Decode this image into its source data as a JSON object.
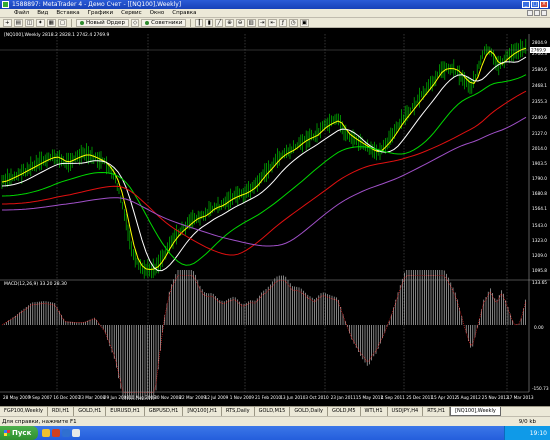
{
  "window": {
    "title": "1588897: MetaTrader 4 - Демо Счет - [[NQ100],Weekly]",
    "buttons": [
      "_",
      "□",
      "×"
    ]
  },
  "menu": {
    "items": [
      "Файл",
      "Вид",
      "Вставка",
      "Графики",
      "Сервис",
      "Окно",
      "Справка"
    ]
  },
  "toolbar": {
    "new_order": "Новый Ордер",
    "advisors": "Советники"
  },
  "chart": {
    "header": "[NQ100],Weekly  2818.2  2828.1  2742.4  2769.9",
    "current_price": "2769.9",
    "price_labels": [
      "2804.9",
      "2700.3",
      "2580.6",
      "2468.1",
      "2355.3",
      "2240.6",
      "2127.0",
      "2014.0",
      "1903.5",
      "1790.0",
      "1680.8",
      "1564.1",
      "1543.0",
      "1323.0",
      "1209.0",
      "1095.8",
      "981.0"
    ],
    "macd_header": "MACD(12,26,9)  33.20  28.30",
    "macd_labels": [
      "133.65",
      "0.00",
      "-150.73"
    ],
    "date_labels": [
      "28 May 2007",
      "9 Sep 2007",
      "16 Dec 2007",
      "23 Mar 2008",
      "29 Jun 2008",
      "10 Aug 2008",
      "30 Nov 2008",
      "22 Mar 2009",
      "12 Jul 2009",
      "1 Nov 2009",
      "21 Feb 2010",
      "13 Jun 2010",
      "3 Oct 2010",
      "23 Jan 2011",
      "15 May 2011",
      "4 Sep 2011",
      "25 Dec 2011",
      "15 Apr 2012",
      "5 Aug 2012",
      "25 Nov 2012",
      "17 Mar 2013"
    ],
    "colors": {
      "ma_yellow": "#ffff00",
      "ma_white": "#ffffff",
      "ma_green": "#00d800",
      "ma_red": "#e01010",
      "ma_violet": "#a050c8",
      "candles": "#00c000",
      "macd_signal": "#ff2020"
    }
  },
  "tabs": [
    "FGP100,Weekly",
    "RDI,H1",
    "GOLD,H1",
    "EURUSD,H1",
    "GBPUSD,H1",
    "[NQ100],H1",
    "RTS,Daily",
    "GOLD,M15",
    "GOLD,Daily",
    "GOLD,M5",
    "WTI,H1",
    "USDJPY,H4",
    "RTS,H1",
    "[NQ100],Weekly"
  ],
  "statusbar": {
    "help": "Для справки, нажмите F1",
    "traffic": "9/0 kb"
  },
  "taskbar": {
    "start": "Пуск",
    "clock": "19:10"
  }
}
